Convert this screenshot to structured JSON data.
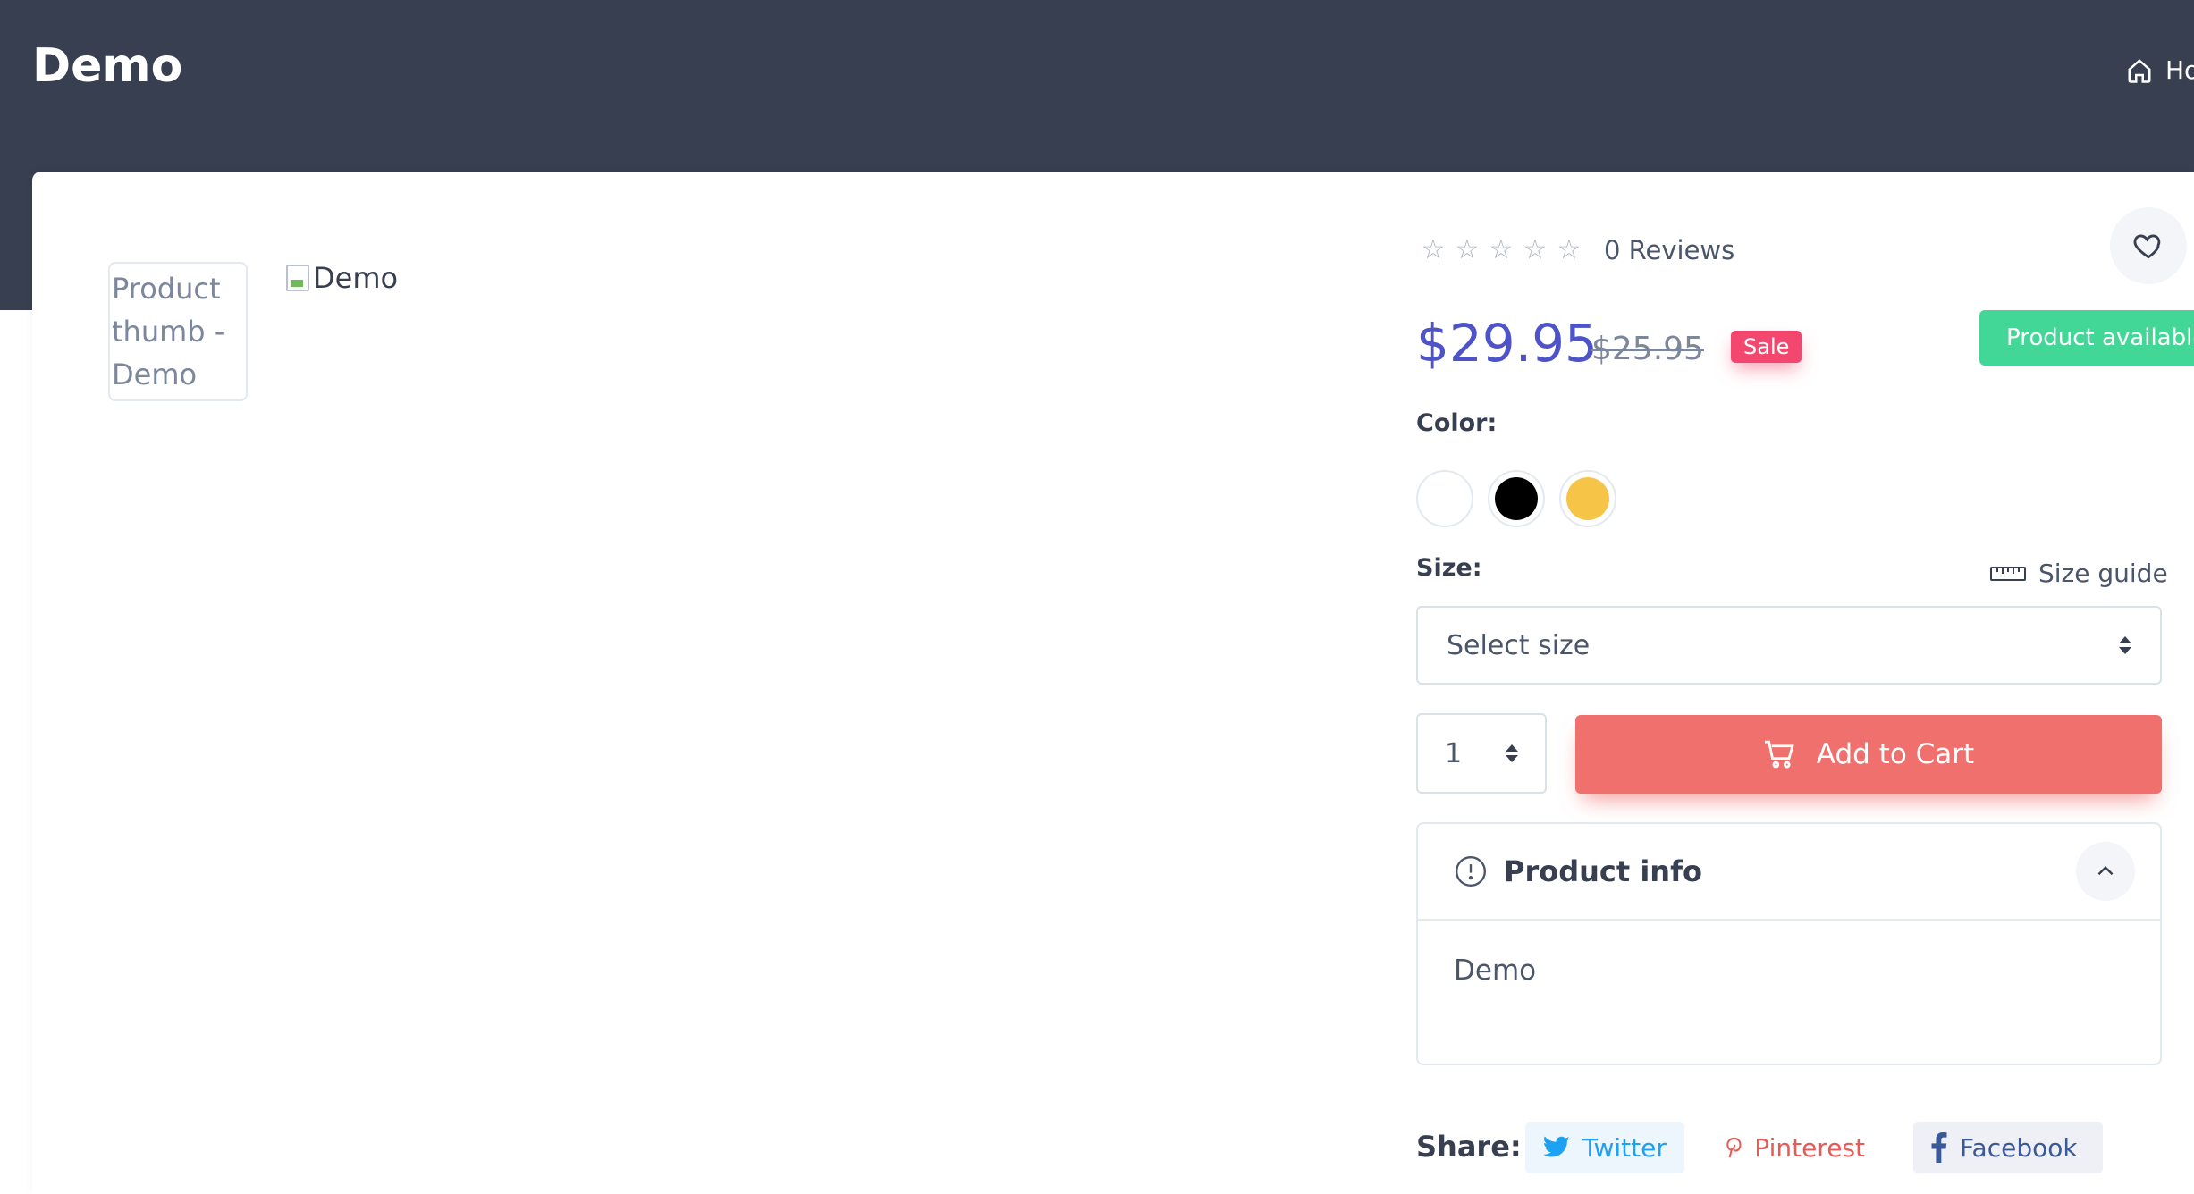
{
  "header": {
    "title": "Demo",
    "nav_home_label": "Ho"
  },
  "gallery": {
    "thumb_alt": "Product thumb - Demo",
    "main_alt": "Demo"
  },
  "product": {
    "rating_stars_filled": 0,
    "reviews_label": "0 Reviews",
    "price": "$29.95",
    "old_price": "$25.95",
    "sale_badge": "Sale",
    "availability_label": "Product available",
    "color_label": "Color:",
    "colors": [
      "#ffffff",
      "#000000",
      "#f6c446"
    ],
    "size_label": "Size:",
    "size_guide_label": "Size guide",
    "size_select_value": "Select size",
    "quantity_value": "1",
    "add_to_cart_label": "Add to Cart",
    "accent_color": "#4e54c8",
    "cart_color": "#ef706c"
  },
  "product_info": {
    "title": "Product info",
    "body": "Demo"
  },
  "share": {
    "label": "Share:",
    "twitter": "Twitter",
    "pinterest": "Pinterest",
    "facebook": "Facebook"
  }
}
